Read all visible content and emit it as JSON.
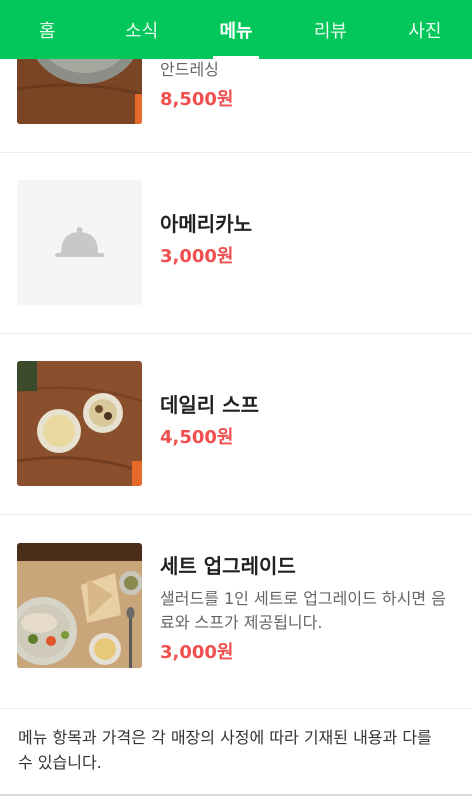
{
  "tabs": [
    {
      "label": "홈",
      "active": false
    },
    {
      "label": "소식",
      "active": false
    },
    {
      "label": "메뉴",
      "active": true
    },
    {
      "label": "리뷰",
      "active": false
    },
    {
      "label": "사진",
      "active": false
    }
  ],
  "menu": [
    {
      "name": "",
      "desc": "안드레싱",
      "price": "8,500원",
      "image": "salad-bowl-photo"
    },
    {
      "name": "아메리카노",
      "desc": "",
      "price": "3,000원",
      "image": "placeholder-cloche-icon"
    },
    {
      "name": "데일리 스프",
      "desc": "",
      "price": "4,500원",
      "image": "soup-bowls-photo"
    },
    {
      "name": "세트 업그레이드",
      "desc": "샐러드를 1인 세트로 업그레이드 하시면 음료와 스프가 제공됩니다.",
      "price": "3,000원",
      "image": "salad-set-photo"
    }
  ],
  "notice": "메뉴 항목과 가격은 각 매장의 사정에 따라 기재된 내용과 다를 수 있습니다.",
  "colors": {
    "accent": "#03c75a",
    "price": "#ef4f4f"
  }
}
